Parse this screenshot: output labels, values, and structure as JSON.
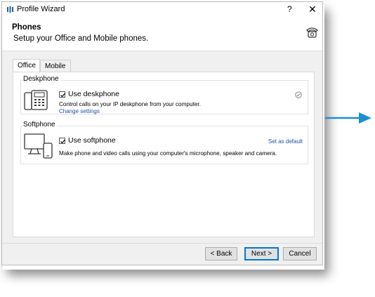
{
  "window": {
    "title": "Profile Wizard",
    "help_glyph": "?",
    "close_glyph": "✕"
  },
  "header": {
    "title": "Phones",
    "subtitle": "Setup your Office and Mobile phones.",
    "icon": "telephone-icon"
  },
  "tabs": [
    {
      "label": "Office",
      "active": true
    },
    {
      "label": "Mobile",
      "active": false
    }
  ],
  "deskphone": {
    "group_label": "Deskphone",
    "checkbox_label": "Use deskphone",
    "checked": true,
    "description": "Control calls on your IP deskphone from your computer.",
    "link": "Change settings",
    "status_icon": "default-check-icon"
  },
  "softphone": {
    "group_label": "Softphone",
    "checkbox_label": "Use softphone",
    "checked": true,
    "description": "Make phone and video calls using your computer's microphone, speaker and camera.",
    "link": "Set as default"
  },
  "buttons": {
    "back": "< Back",
    "next": "Next >",
    "cancel": "Cancel"
  },
  "colors": {
    "accent": "#0078d7",
    "link": "#1a4fa0",
    "arrow": "#1a8fd1"
  }
}
